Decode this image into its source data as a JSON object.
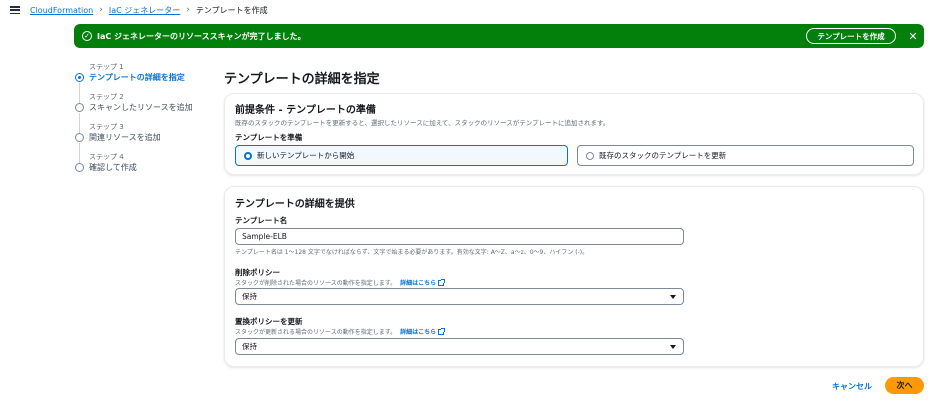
{
  "breadcrumb": {
    "items": [
      "CloudFormation",
      "IaC ジェネレーター"
    ],
    "current": "テンプレートを作成"
  },
  "flash": {
    "message": "IaC ジェネレーターのリソーススキャンが完了しました。",
    "action_label": "テンプレートを作成",
    "status_icon": "success-check-icon",
    "color": "#037f0c"
  },
  "steps": [
    {
      "number": "ステップ 1",
      "label": "テンプレートの詳細を指定",
      "active": true
    },
    {
      "number": "ステップ 2",
      "label": "スキャンしたリソースを追加",
      "active": false
    },
    {
      "number": "ステップ 3",
      "label": "関連リソースを追加",
      "active": false
    },
    {
      "number": "ステップ 4",
      "label": "確認して作成",
      "active": false
    }
  ],
  "page_title": "テンプレートの詳細を指定",
  "prereq": {
    "title": "前提条件 - テンプレートの準備",
    "description": "既存のスタックのテンプレートを更新すると、選択したリソースに加えて、スタックのリソースがテンプレートに追加されます。",
    "field_label": "テンプレートを準備",
    "options": [
      "新しいテンプレートから開始",
      "既存のスタックのテンプレートを更新"
    ],
    "selected_index": 0
  },
  "details": {
    "title": "テンプレートの詳細を提供",
    "name_label": "テンプレート名",
    "name_value": "Sample-ELB",
    "name_hint": "テンプレート名は 1〜128 文字でなければならず、文字で始まる必要があります。有効な文字: A〜Z、a〜z、0〜9、ハイフン (-)。",
    "deletion_label": "削除ポリシー",
    "deletion_hint": "スタックが削除された場合のリソースの動作を指定します。",
    "deletion_value": "保持",
    "replace_label": "置換ポリシーを更新",
    "replace_hint": "スタックが更新される場合のリソースの動作を指定します。",
    "replace_value": "保持",
    "learn_more": "詳細はこちら"
  },
  "footer": {
    "cancel_label": "キャンセル",
    "next_label": "次へ"
  },
  "colors": {
    "accent": "#0972d3",
    "primary_button": "#ff9900",
    "success": "#037f0c"
  }
}
